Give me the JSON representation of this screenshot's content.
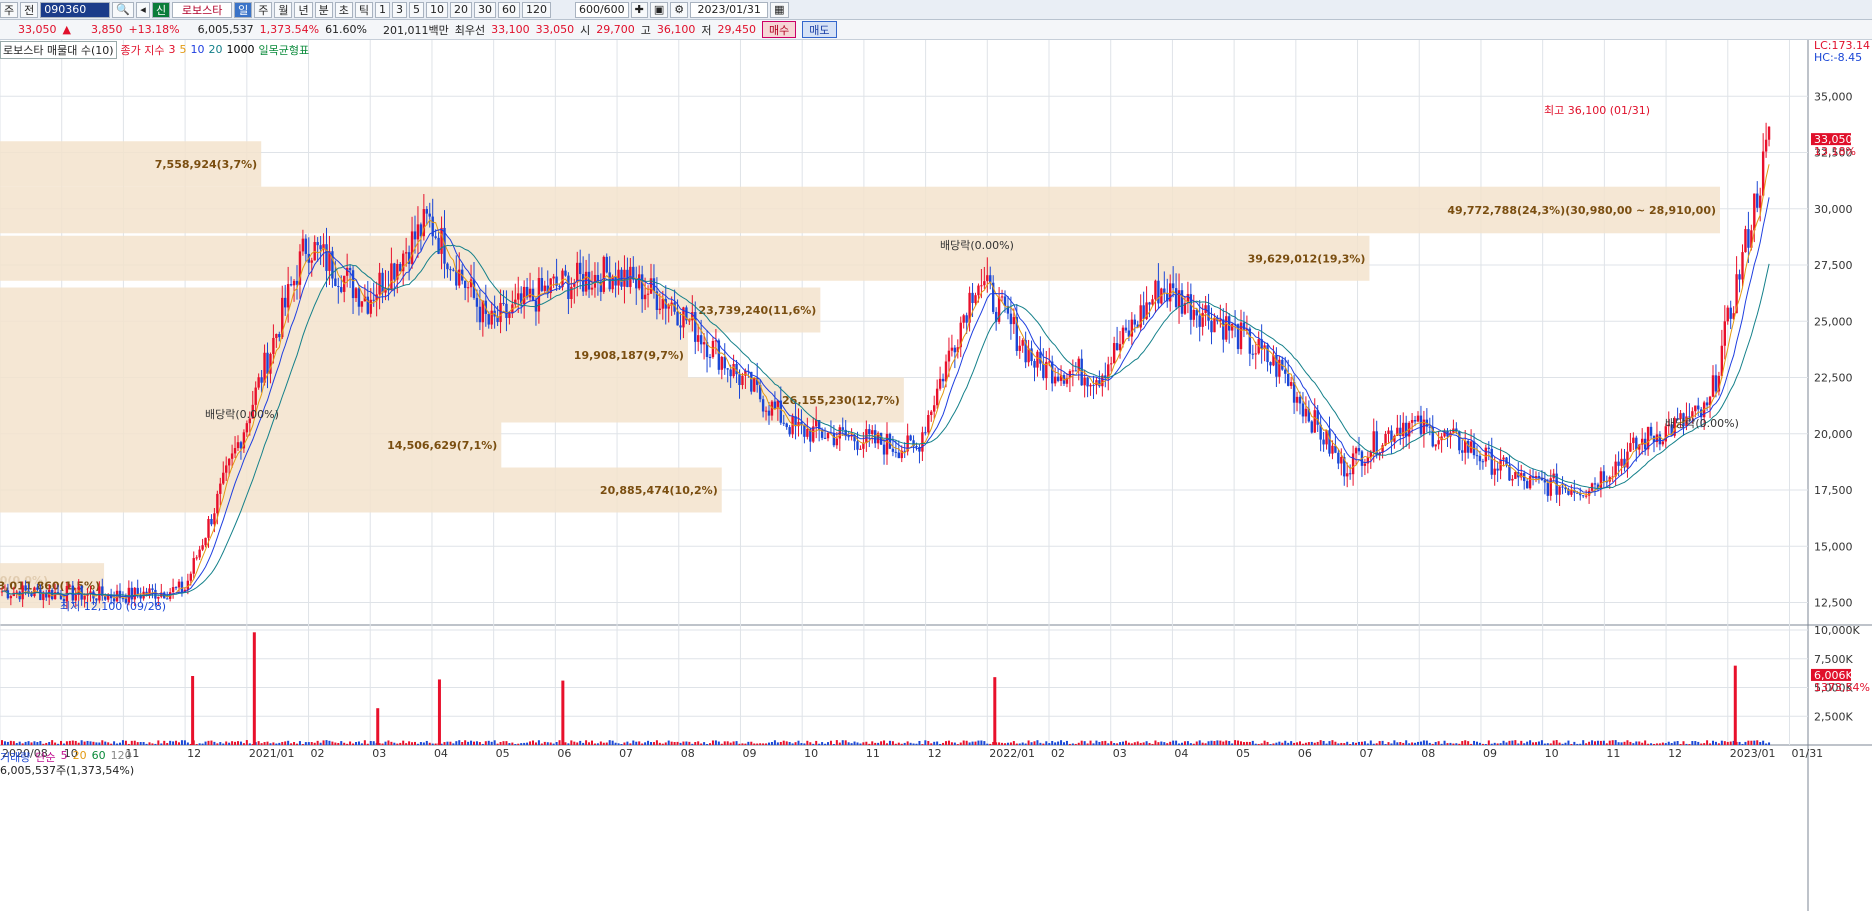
{
  "toolbar": {
    "items": [
      "주",
      "전",
      "090360",
      "신",
      "로보스타",
      "일",
      "주",
      "월",
      "년",
      "분",
      "초",
      "틱",
      "1",
      "3",
      "5",
      "10",
      "20",
      "30",
      "60",
      "120",
      "600/600",
      "2023/01/31"
    ],
    "code": "090360",
    "name_prefix": "신",
    "name": "로보스타",
    "period_active": "일",
    "periods": [
      "주",
      "월",
      "년",
      "분",
      "초",
      "틱"
    ],
    "minutes": [
      "1",
      "3",
      "5",
      "10",
      "20",
      "30",
      "60",
      "120"
    ],
    "count": "600/600",
    "date": "2023/01/31"
  },
  "quote": {
    "price": "33,050",
    "arrow": "▲",
    "change": "3,850",
    "change_pct": "+13.18%",
    "volume": "6,005,537",
    "vol_pct": "1,373.54%",
    "turnover": "61.60%",
    "amount": "201,011백만",
    "best_label": "최우선",
    "best_ask": "33,100",
    "best_bid": "33,050",
    "open_label": "시",
    "open": "29,700",
    "high_label": "고",
    "high": "36,100",
    "low_label": "저",
    "low": "29,450",
    "buy": "매수",
    "sell": "매도"
  },
  "legend": {
    "name": "로보스타 매물대 수(10)",
    "close_label": "종가 지수",
    "ma": [
      "3",
      "5",
      "10",
      "20",
      "1000"
    ],
    "ichimoku": "일목균형표"
  },
  "colors": {
    "up": "#e8102b",
    "down": "#1b47d6",
    "ma3": "#e0102b",
    "ma5": "#e39a13",
    "ma10": "#1f3fe0",
    "ma20": "#14808a",
    "profile": "#f3e3cc",
    "profile_text": "#7a4e10",
    "grid": "#dfe3e8"
  },
  "chart_data": [
    {
      "type": "candlestick",
      "title": "",
      "x": [
        "2020/08",
        "10",
        "11",
        "12",
        "2021/01",
        "02",
        "03",
        "04",
        "05",
        "06",
        "07",
        "08",
        "09",
        "10",
        "11",
        "12",
        "2022/01",
        "02",
        "03",
        "04",
        "05",
        "06",
        "07",
        "08",
        "09",
        "10",
        "11",
        "12",
        "2023/01",
        "01/31"
      ],
      "monthly_close": [
        13000,
        12900,
        12800,
        13100,
        20500,
        28500,
        26000,
        29500,
        24800,
        26500,
        27200,
        25800,
        22800,
        20200,
        19800,
        19300,
        27000,
        23000,
        22600,
        26500,
        25000,
        22800,
        18500,
        20500,
        19500,
        17800,
        17600,
        19800,
        21000,
        33050
      ],
      "ylim": [
        11500,
        37500
      ],
      "y_ticks": [
        "12,500",
        "15,000",
        "17,500",
        "20,000",
        "22,500",
        "25,000",
        "27,500",
        "30,000",
        "32,500",
        "35,000"
      ],
      "last": "33,050",
      "last_pct": "13.18%",
      "lc_label": "LC:173.14",
      "hc_label": "HC:-8.45",
      "annotations": {
        "high": "최고 36,100 (01/31)",
        "low": "최저 12,100 (09/28)",
        "dividend": "배당락(0.00%)"
      },
      "volume_profile": [
        {
          "label": "0(0,0%)",
          "low": 12500,
          "high": 14500,
          "value": 0
        },
        {
          "label": "3,011,860(1,5%)",
          "low": 12250,
          "high": 14250,
          "value": 3011860
        },
        {
          "label": "20,885,474(10,2%)",
          "low": 16500,
          "high": 18500,
          "value": 20885474
        },
        {
          "label": "14,506,629(7,1%)",
          "low": 18500,
          "high": 20500,
          "value": 14506629
        },
        {
          "label": "26,155,230(12,7%)",
          "low": 20500,
          "high": 22500,
          "value": 26155230
        },
        {
          "label": "19,908,187(9,7%)",
          "low": 22500,
          "high": 24500,
          "value": 19908187
        },
        {
          "label": "23,739,240(11,6%)",
          "low": 24500,
          "high": 26500,
          "value": 23739240
        },
        {
          "label": "39,629,012(19,3%)",
          "low": 26800,
          "high": 28800,
          "value": 39629012
        },
        {
          "label": "49,772,788(24,3%)(30,980,00 ~ 28,910,00)",
          "low": 28910,
          "high": 30980,
          "value": 49772788
        },
        {
          "label": "7,558,924(3,7%)",
          "low": 30980,
          "high": 33000,
          "value": 7558924
        }
      ]
    },
    {
      "type": "bar",
      "title": "거래량",
      "legend": [
        "거래량",
        "단순",
        "5",
        "20",
        "60",
        "120"
      ],
      "summary": "6,005,537주(1,373,54%)",
      "y_ticks": [
        "2,500K",
        "5,000K",
        "7,500K",
        "10,000K"
      ],
      "last": "6,006K",
      "last_pct": "1373,54%",
      "ylim": [
        0,
        10000
      ],
      "peaks": [
        {
          "month": "12",
          "value": 6000
        },
        {
          "month": "2021/01",
          "value": 9800
        },
        {
          "month": "04",
          "value": 5700
        },
        {
          "month": "2022/01",
          "value": 5900
        },
        {
          "month": "03",
          "value": 3200
        },
        {
          "month": "06",
          "value": 5600
        },
        {
          "month": "2023/01",
          "value": 6900
        }
      ]
    }
  ]
}
